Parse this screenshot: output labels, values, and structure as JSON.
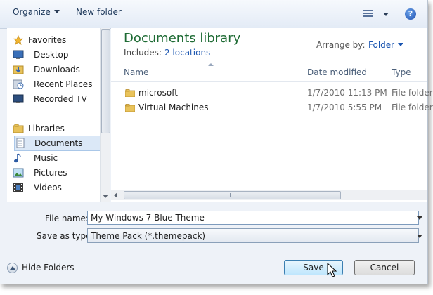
{
  "toolbar": {
    "organize": "Organize",
    "new_folder": "New folder",
    "help": "?"
  },
  "nav": {
    "favorites": {
      "label": "Favorites",
      "items": [
        "Desktop",
        "Downloads",
        "Recent Places",
        "Recorded TV"
      ]
    },
    "libraries": {
      "label": "Libraries",
      "items": [
        "Documents",
        "Music",
        "Pictures",
        "Videos"
      ],
      "selected": "Documents"
    }
  },
  "main": {
    "title": "Documents library",
    "includes_label": "Includes:",
    "includes_link": "2 locations",
    "arrange_label": "Arrange by:",
    "arrange_value": "Folder",
    "columns": {
      "name": "Name",
      "date": "Date modified",
      "type": "Type"
    },
    "rows": [
      {
        "name": "microsoft",
        "date": "1/7/2010 11:13 PM",
        "type": "File folder"
      },
      {
        "name": "Virtual Machines",
        "date": "1/7/2010 5:55 PM",
        "type": "File folder"
      }
    ]
  },
  "form": {
    "file_name_label": "File name:",
    "file_name_value": "My Windows 7 Blue Theme",
    "save_as_label": "Save as type:",
    "save_as_value": "Theme Pack (*.themepack)"
  },
  "footer": {
    "hide_folders": "Hide Folders",
    "save": "Save",
    "cancel": "Cancel"
  },
  "colors": {
    "title_green": "#1e6b34",
    "link_blue": "#1a55b0",
    "selection": "#dbe8f7"
  }
}
